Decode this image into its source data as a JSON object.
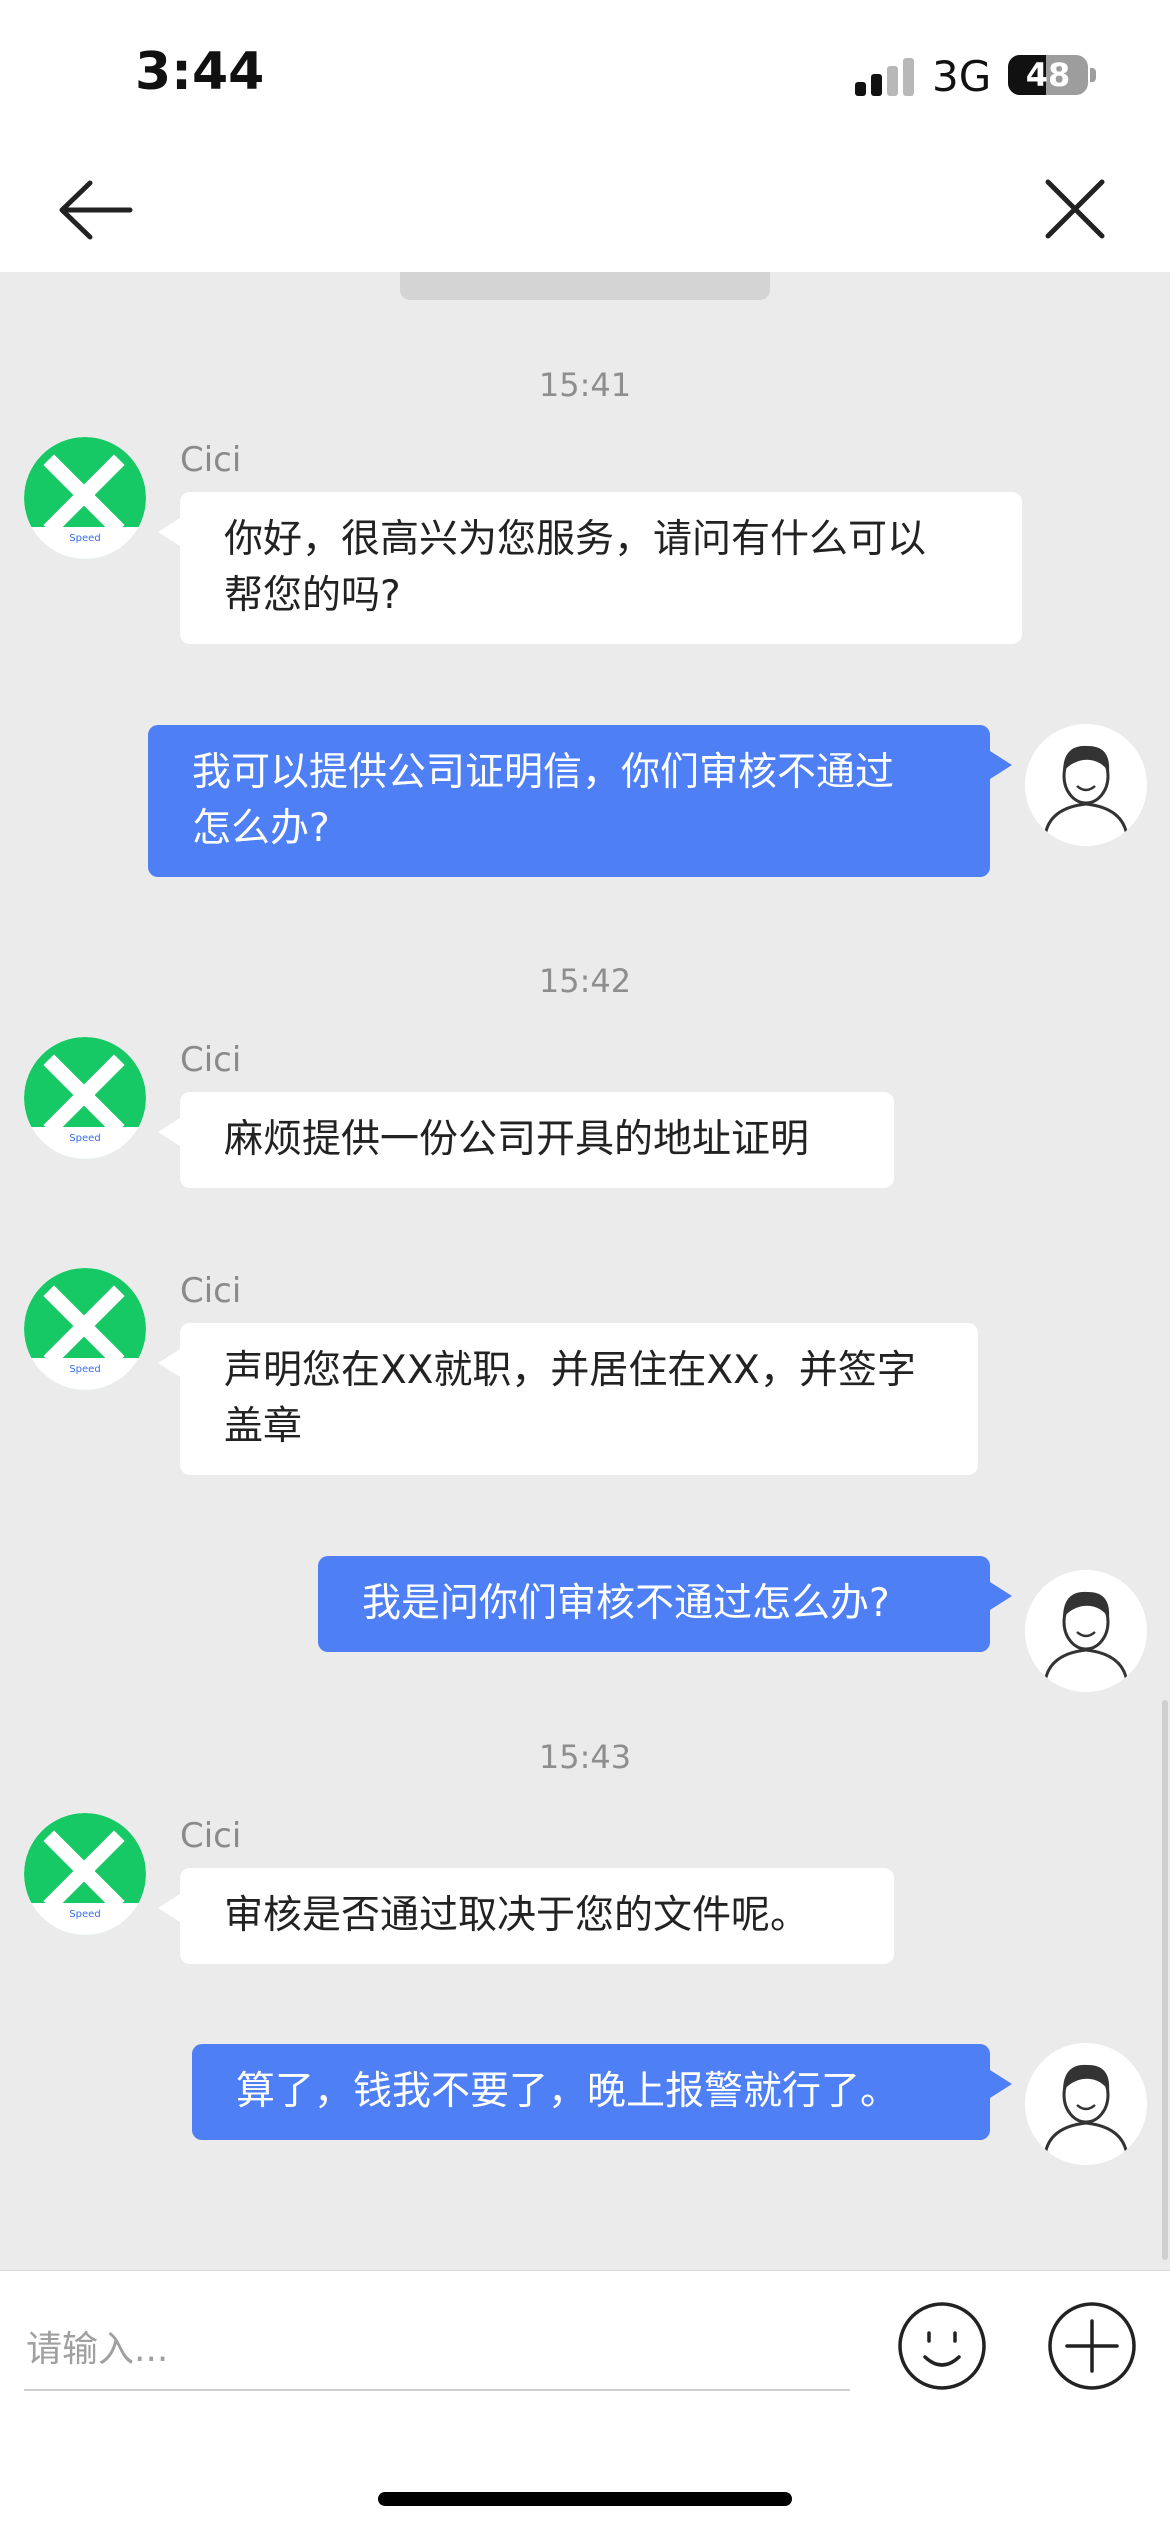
{
  "status_bar": {
    "time": "3:44",
    "network": "3G",
    "battery": "48",
    "battery_level": 0.48
  },
  "nav": {
    "back_icon": "arrow-left-icon",
    "close_icon": "close-icon"
  },
  "chat": {
    "timestamps": [
      "15:41",
      "15:42",
      "15:43"
    ],
    "messages": [
      {
        "from": "agent",
        "sender": "Cici",
        "text": "你好，很高兴为您服务，请问有什么可以\n帮您的吗?"
      },
      {
        "from": "user",
        "text": "我可以提供公司证明信，你们审核不通过\n怎么办?"
      },
      {
        "from": "agent",
        "sender": "Cici",
        "text": "麻烦提供一份公司开具的地址证明"
      },
      {
        "from": "agent",
        "sender": "Cici",
        "text": "声明您在XX就职，并居住在XX，并签字\n盖章"
      },
      {
        "from": "user",
        "text": "我是问你们审核不通过怎么办?"
      },
      {
        "from": "agent",
        "sender": "Cici",
        "text": "审核是否通过取决于您的文件呢。"
      },
      {
        "from": "user",
        "text": "算了，钱我不要了，晚上报警就行了。"
      }
    ],
    "agent_avatar": {
      "icon": "x-logo-icon",
      "brand_color": "#16c964",
      "caption": "Speed"
    },
    "user_avatar_icon": "user-avatar-icon",
    "bubble_colors": {
      "agent": "#ffffff",
      "user": "#4f7ff4"
    }
  },
  "input_bar": {
    "placeholder": "请输入...",
    "emoji_icon": "smiley-icon",
    "plus_icon": "plus-circle-icon"
  }
}
